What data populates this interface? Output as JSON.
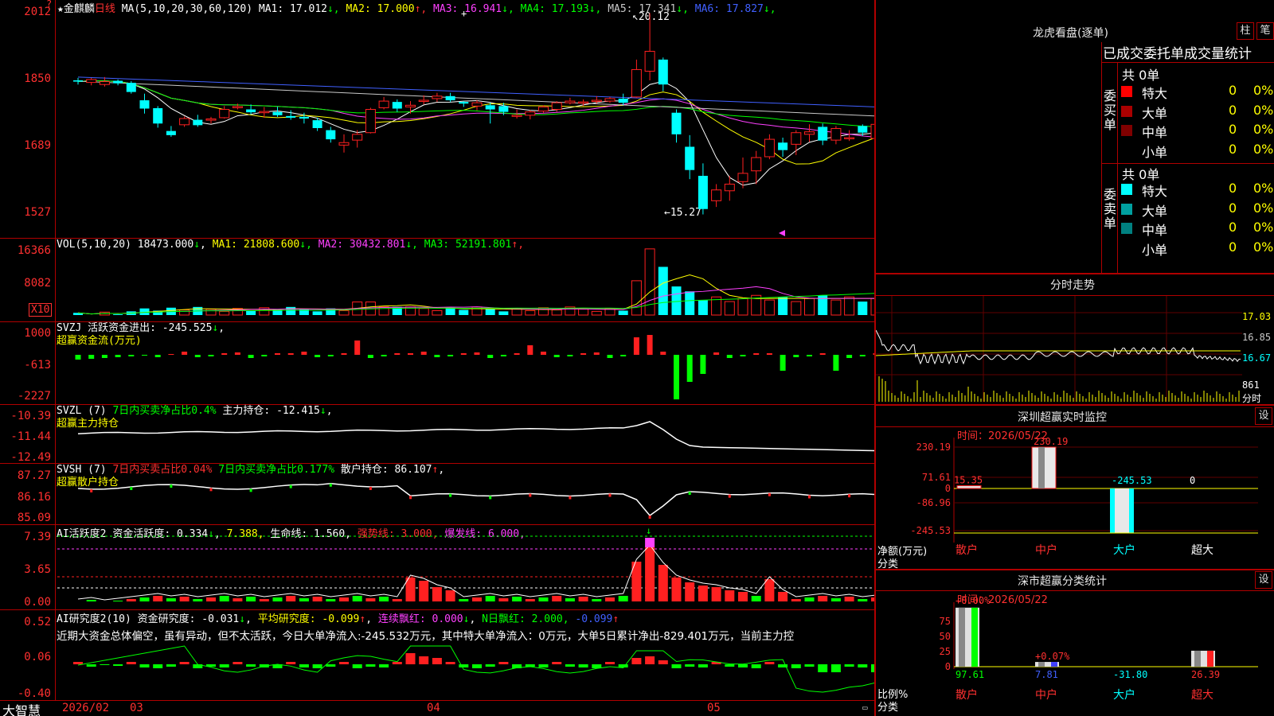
{
  "stock": {
    "name": "金麒麟",
    "period": "日线",
    "star": "★"
  },
  "main_chart": {
    "ma_label": "MA(5,10,20,30,60,120)",
    "ma": [
      {
        "k": "MA1:",
        "v": "17.012",
        "arrow": "↓",
        "color": "#ffffff"
      },
      {
        "k": "MA2:",
        "v": "17.000",
        "arrow": "↑",
        "color": "#ffff00"
      },
      {
        "k": "MA3:",
        "v": "16.941",
        "arrow": "↓",
        "color": "#ff40ff"
      },
      {
        "k": "MA4:",
        "v": "17.193",
        "arrow": "↓",
        "color": "#00ff00"
      },
      {
        "k": "MA5:",
        "v": "17.341",
        "arrow": "↓",
        "color": "#c8c8c8"
      },
      {
        "k": "MA6:",
        "v": "17.827",
        "arrow": "↓",
        "color": "#4060ff"
      }
    ],
    "y_ticks": [
      "2012",
      "1850",
      "1689",
      "1527"
    ],
    "high_label": "20.12",
    "low_label": "15.27",
    "candles": [
      [
        -4,
        18.5,
        18.56,
        18.4,
        18.47
      ],
      [
        -3,
        18.45,
        18.56,
        18.38,
        18.52
      ],
      [
        -2,
        18.4,
        18.58,
        18.35,
        18.47
      ],
      [
        -1,
        18.49,
        18.52,
        18.38,
        18.43
      ],
      [
        0,
        18.44,
        18.48,
        18.18,
        18.22
      ],
      [
        1,
        18.02,
        18.18,
        17.7,
        17.82
      ],
      [
        2,
        17.83,
        17.88,
        17.36,
        17.46
      ],
      [
        3,
        17.28,
        17.4,
        17.14,
        17.18
      ],
      [
        4,
        17.43,
        17.63,
        17.38,
        17.58
      ],
      [
        5,
        17.55,
        17.67,
        17.38,
        17.42
      ],
      [
        6,
        17.54,
        17.62,
        17.46,
        17.57
      ],
      [
        7,
        17.6,
        17.88,
        17.58,
        17.8
      ],
      [
        8,
        17.86,
        17.94,
        17.8,
        17.87
      ],
      [
        9,
        17.8,
        17.92,
        17.68,
        17.73
      ],
      [
        10,
        17.72,
        17.86,
        17.6,
        17.75
      ],
      [
        11,
        17.74,
        17.86,
        17.62,
        17.66
      ],
      [
        12,
        17.64,
        17.78,
        17.55,
        17.6
      ],
      [
        13,
        17.62,
        17.72,
        17.46,
        17.58
      ],
      [
        14,
        17.54,
        17.6,
        17.28,
        17.35
      ],
      [
        15,
        17.3,
        17.38,
        17.0,
        17.08
      ],
      [
        16,
        16.94,
        17.2,
        16.76,
        17.0
      ],
      [
        17,
        17.06,
        17.3,
        16.88,
        17.2
      ],
      [
        18,
        17.24,
        17.84,
        17.22,
        17.8
      ],
      [
        19,
        17.84,
        18.1,
        17.8,
        18.0
      ],
      [
        20,
        17.98,
        18.04,
        17.74,
        17.82
      ],
      [
        21,
        17.86,
        18.0,
        17.7,
        17.9
      ],
      [
        22,
        18.0,
        18.14,
        17.92,
        18.02
      ],
      [
        23,
        18.06,
        18.2,
        17.98,
        18.12
      ],
      [
        24,
        18.12,
        18.2,
        17.98,
        18.02
      ],
      [
        25,
        17.98,
        18.0,
        17.86,
        17.94
      ],
      [
        26,
        17.88,
        18.02,
        17.78,
        17.96
      ],
      [
        27,
        17.9,
        17.96,
        17.46,
        17.8
      ],
      [
        28,
        17.88,
        17.96,
        17.66,
        17.74
      ],
      [
        29,
        17.66,
        17.8,
        17.58,
        17.66
      ],
      [
        30,
        17.66,
        17.78,
        17.56,
        17.74
      ],
      [
        31,
        17.76,
        17.9,
        17.72,
        17.86
      ],
      [
        32,
        17.8,
        18.0,
        17.74,
        17.96
      ],
      [
        33,
        17.96,
        18.08,
        17.92,
        18.0
      ],
      [
        34,
        17.96,
        18.04,
        17.88,
        17.98
      ],
      [
        35,
        18.0,
        18.12,
        17.94,
        18.02
      ],
      [
        36,
        18.0,
        18.1,
        17.96,
        18.06
      ],
      [
        37,
        18.06,
        18.18,
        17.9,
        17.96
      ],
      [
        38,
        18.1,
        19.0,
        18.08,
        18.76
      ],
      [
        39,
        18.72,
        20.12,
        18.5,
        19.2
      ],
      [
        40,
        19.0,
        19.05,
        18.24,
        18.4
      ],
      [
        41,
        17.72,
        17.8,
        17.0,
        17.2
      ],
      [
        42,
        16.9,
        17.18,
        16.12,
        16.34
      ],
      [
        43,
        16.2,
        16.5,
        15.27,
        15.4
      ],
      [
        44,
        15.6,
        16.0,
        15.45,
        15.86
      ],
      [
        45,
        15.84,
        16.2,
        15.6,
        16.0
      ],
      [
        46,
        16.06,
        16.64,
        15.9,
        16.26
      ],
      [
        47,
        16.32,
        16.8,
        16.0,
        16.64
      ],
      [
        48,
        16.66,
        17.2,
        16.6,
        17.08
      ],
      [
        49,
        17.0,
        17.12,
        16.66,
        16.82
      ],
      [
        50,
        16.96,
        17.3,
        16.7,
        17.24
      ],
      [
        51,
        17.2,
        17.44,
        17.02,
        17.26
      ],
      [
        52,
        17.38,
        17.46,
        16.94,
        17.05
      ],
      [
        53,
        17.06,
        17.4,
        16.96,
        17.34
      ],
      [
        54,
        17.1,
        17.3,
        17.04,
        17.12
      ],
      [
        55,
        17.4,
        17.44,
        17.16,
        17.24
      ],
      [
        56,
        17.1,
        17.44,
        17.0,
        17.44
      ],
      [
        57,
        17.48,
        17.56,
        17.38,
        17.48
      ],
      [
        58,
        17.48,
        17.58,
        17.36,
        17.42
      ],
      [
        59,
        17.52,
        17.58,
        17.28,
        17.32
      ],
      [
        60,
        17.42,
        17.44,
        17.1,
        17.24
      ],
      [
        61,
        17.26,
        17.3,
        16.9,
        16.96
      ]
    ]
  },
  "vol_panel": {
    "label": "VOL(5,10,20)",
    "value": "18473.000",
    "value_arrow": "↓",
    "ma": [
      {
        "k": "MA1:",
        "v": "21808.600",
        "arrow": "↓",
        "color": "#ffff00"
      },
      {
        "k": "MA2:",
        "v": "30432.801",
        "arrow": "↓",
        "color": "#ff40ff"
      },
      {
        "k": "MA3:",
        "v": "52191.801",
        "arrow": "↑",
        "color": "#00ff00"
      }
    ],
    "y_ticks": [
      "16366",
      "8082"
    ],
    "unit": "X10"
  },
  "svzj": {
    "name": "SVZJ",
    "k": "活跃资金进出:",
    "v": "-245.525",
    "arrow": "↓",
    "sub": "超赢资金流(万元)",
    "y_ticks": [
      "1000",
      "-613",
      "-2227"
    ]
  },
  "svzl": {
    "name": "SVZL",
    "param": "(7)",
    "desc": "7日内买卖净占比0.4%",
    "k": "主力持仓:",
    "v": "-12.415",
    "arrow": "↓",
    "sub": "超赢主力持仓",
    "y_ticks": [
      "-10.39",
      "-11.44",
      "-12.49"
    ]
  },
  "svsh": {
    "name": "SVSH",
    "param": "(7)",
    "desc1": "7日内买卖占比0.04%",
    "desc2": "7日内买卖净占比0.177%",
    "k": "散户持仓:",
    "v": "86.107",
    "arrow": "↑",
    "sub": "超赢散户持仓",
    "y_ticks": [
      "87.27",
      "86.16",
      "85.09"
    ]
  },
  "ai_active": {
    "name": "AI活跃度2",
    "k1": "资金活跃度:",
    "v1": "0.334",
    "a1": "↓",
    "v2": "7.388,",
    "k3": "生命线:",
    "v3": "1.560,",
    "k4": "强势线:",
    "v4": "3.000,",
    "k5": "爆发线:",
    "v5": "6.000,",
    "y_ticks": [
      "7.39",
      "3.65",
      "0.00"
    ]
  },
  "ai_research": {
    "name": "AI研究度2(10)",
    "k1": "资金研究度:",
    "v1": "-0.031",
    "a1": "↓",
    "k2": "平均研究度:",
    "v2": "-0.099",
    "a2": "↑",
    "k3": "连续飘红:",
    "v3": "0.000",
    "a3": "↓",
    "k4": "N日飘红:",
    "v4": "2.000,",
    "v5": "-0.099",
    "a5": "↑",
    "summary": "近期大资金总体偏空，虽有异动，但不太活跃，今日大单净流入:-245.532万元，其中特大单净流入：0万元，大单5日累计净出-829.401万元，当前主力控",
    "y_ticks": [
      "0.52",
      "0.06",
      "-0.40"
    ]
  },
  "x_axis": {
    "labels": [
      "2026/02",
      "03",
      "04",
      "05"
    ],
    "brand": "大智慧"
  },
  "lhb": {
    "title": "龙虎看盘(逐单)",
    "btn1": "柱",
    "btn2": "笔",
    "header": "已成交委托单成交量统计",
    "buy": {
      "label": "委买单",
      "total": "共 0单",
      "rows": [
        {
          "name": "特大",
          "count": "0",
          "pct": "0%",
          "color": "#ff0000"
        },
        {
          "name": "大单",
          "count": "0",
          "pct": "0%",
          "color": "#aa0000"
        },
        {
          "name": "中单",
          "count": "0",
          "pct": "0%",
          "color": "#800000"
        },
        {
          "name": "小单",
          "count": "0",
          "pct": "0%",
          "color": ""
        }
      ]
    },
    "sell": {
      "label": "委卖单",
      "total": "共 0单",
      "rows": [
        {
          "name": "特大",
          "count": "0",
          "pct": "0%",
          "color": "#00ffff"
        },
        {
          "name": "大单",
          "count": "0",
          "pct": "0%",
          "color": "#00a0a0"
        },
        {
          "name": "中单",
          "count": "0",
          "pct": "0%",
          "color": "#008080"
        },
        {
          "name": "小单",
          "count": "0",
          "pct": "0%",
          "color": ""
        }
      ]
    }
  },
  "intraday": {
    "title": "分时走势",
    "y_ticks": [
      "17.03",
      "16.85",
      "16.67"
    ],
    "vol_label": "861",
    "vol_unit": "分时"
  },
  "sz_monitor": {
    "title": "深圳超赢实时监控",
    "btn": "设",
    "time_label": "时间：2026/05/22",
    "y_ticks": [
      "230.19",
      "71.61",
      "0",
      "-86.96",
      "-245.53"
    ],
    "bars": [
      {
        "cat": "散户",
        "value": 15.35,
        "label": "15.35"
      },
      {
        "cat": "中户",
        "value": 230.19,
        "label": "230.19"
      },
      {
        "cat": "大户",
        "value": -245.53,
        "label": "-245.53"
      },
      {
        "cat": "超大",
        "value": 0,
        "label": "0"
      }
    ],
    "ylabel": "净额(万元)",
    "xlabel": "分类"
  },
  "sz_class": {
    "title": "深市超赢分类统计",
    "btn": "设",
    "time_label": "时间：2026/05/22",
    "y_ticks": [
      "75",
      "50",
      "25",
      "0"
    ],
    "top_labels": [
      "+0.00%",
      "+0.07%"
    ],
    "bars": [
      {
        "cat": "散户",
        "value": 97.61,
        "label": "97.61"
      },
      {
        "cat": "中户",
        "value": 7.81,
        "label": "7.81"
      },
      {
        "cat": "大户",
        "value": -31.8,
        "label": "-31.80"
      },
      {
        "cat": "超大",
        "value": 26.39,
        "label": "26.39"
      }
    ],
    "ylabel": "比例%",
    "xlabel": "分类"
  }
}
